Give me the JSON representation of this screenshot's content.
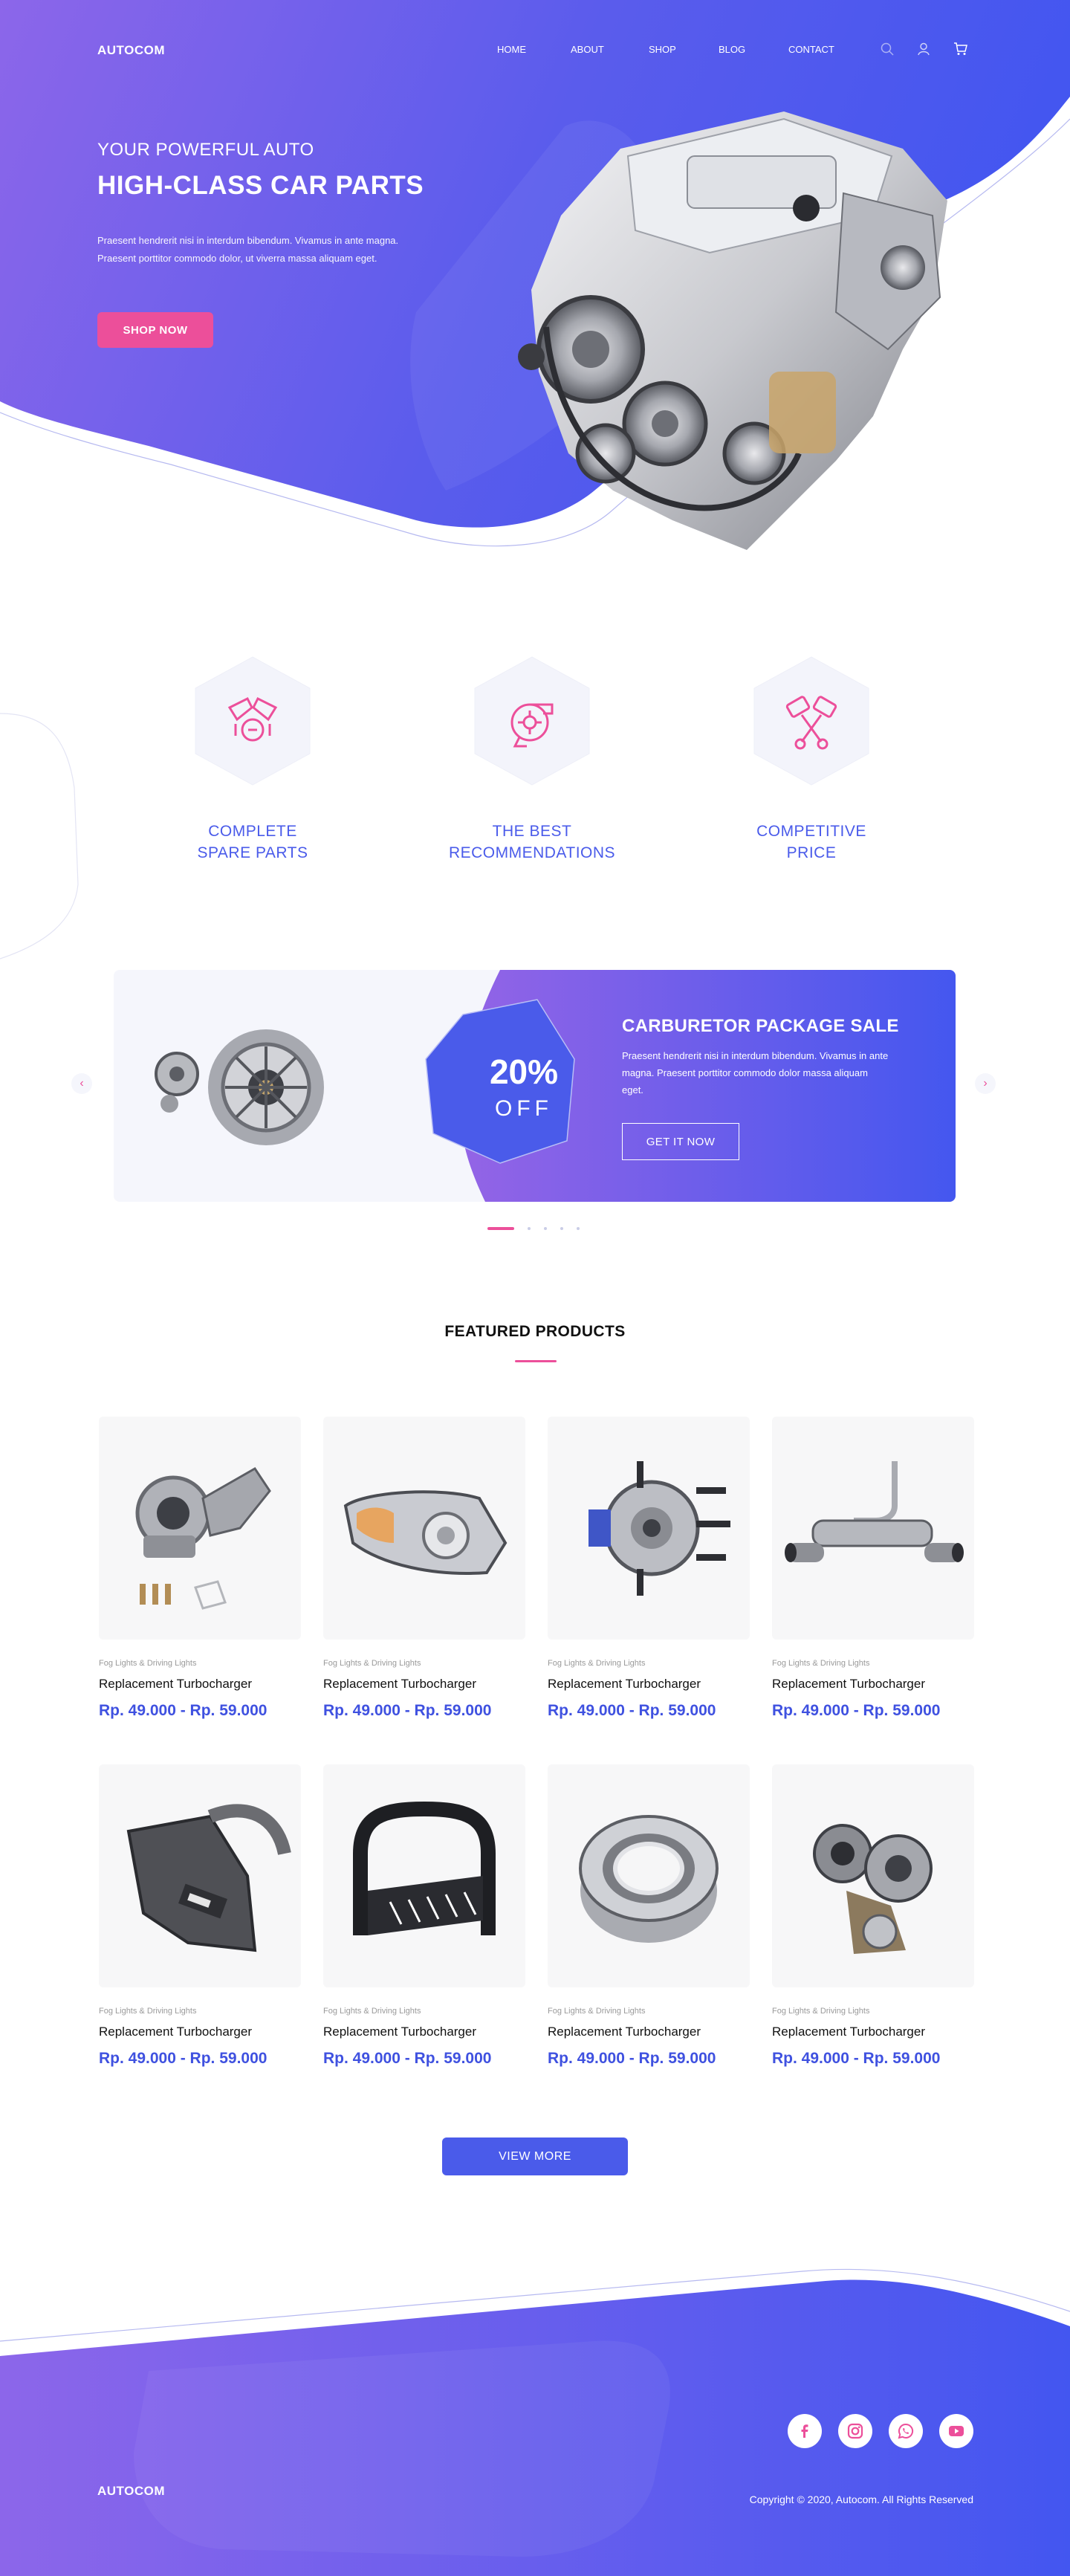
{
  "brand": "AUTOCOM",
  "nav": {
    "items": [
      "HOME",
      "ABOUT",
      "SHOP",
      "BLOG",
      "CONTACT"
    ],
    "icons": [
      "search-icon",
      "user-icon",
      "cart-icon"
    ]
  },
  "hero": {
    "subtitle": "YOUR POWERFUL AUTO",
    "title": "HIGH-CLASS CAR PARTS",
    "description": "Praesent hendrerit nisi in interdum bibendum. Vivamus in ante magna. Praesent porttitor commodo dolor, ut viverra massa aliquam eget.",
    "button": "SHOP NOW"
  },
  "features": [
    {
      "label_line1": "COMPLETE",
      "label_line2": "SPARE PARTS",
      "icon": "engine-icon"
    },
    {
      "label_line1": "THE BEST",
      "label_line2": "RECOMMENDATIONS",
      "icon": "turbo-icon"
    },
    {
      "label_line1": "COMPETITIVE",
      "label_line2": "PRICE",
      "icon": "pistons-icon"
    }
  ],
  "promo": {
    "discount": "20%",
    "off": "OFF",
    "title": "CARBURETOR PACKAGE SALE",
    "description": "Praesent hendrerit nisi in interdum bibendum. Vivamus in ante magna. Praesent porttitor commodo dolor massa aliquam eget.",
    "button": "GET IT NOW",
    "slides_total": 5,
    "active_slide": 1
  },
  "featured": {
    "title": "FEATURED PRODUCTS",
    "products": [
      {
        "category": "Fog Lights & Driving Lights",
        "name": "Replacement Turbocharger",
        "price": "Rp. 49.000 - Rp. 59.000",
        "image": "turbocharger"
      },
      {
        "category": "Fog Lights & Driving Lights",
        "name": "Replacement Turbocharger",
        "price": "Rp. 49.000 - Rp. 59.000",
        "image": "headlight"
      },
      {
        "category": "Fog Lights & Driving Lights",
        "name": "Replacement Turbocharger",
        "price": "Rp. 49.000 - Rp. 59.000",
        "image": "wheel-hub"
      },
      {
        "category": "Fog Lights & Driving Lights",
        "name": "Replacement Turbocharger",
        "price": "Rp. 49.000 - Rp. 59.000",
        "image": "exhaust"
      },
      {
        "category": "Fog Lights & Driving Lights",
        "name": "Replacement Turbocharger",
        "price": "Rp. 49.000 - Rp. 59.000",
        "image": "air-intake"
      },
      {
        "category": "Fog Lights & Driving Lights",
        "name": "Replacement Turbocharger",
        "price": "Rp. 49.000 - Rp. 59.000",
        "image": "bull-bar"
      },
      {
        "category": "Fog Lights & Driving Lights",
        "name": "Replacement Turbocharger",
        "price": "Rp. 49.000 - Rp. 59.000",
        "image": "bearing"
      },
      {
        "category": "Fog Lights & Driving Lights",
        "name": "Replacement Turbocharger",
        "price": "Rp. 49.000 - Rp. 59.000",
        "image": "turbo-2"
      }
    ],
    "button": "VIEW MORE"
  },
  "footer": {
    "brand": "AUTOCOM",
    "copyright": "Copyright © 2020, Autocom. All Rights Reserved",
    "social": [
      "facebook-icon",
      "instagram-icon",
      "whatsapp-icon",
      "youtube-icon"
    ]
  },
  "colors": {
    "primary": "#4a5bea",
    "gradient_start": "#8a63ea",
    "accent": "#ec4f9a"
  }
}
